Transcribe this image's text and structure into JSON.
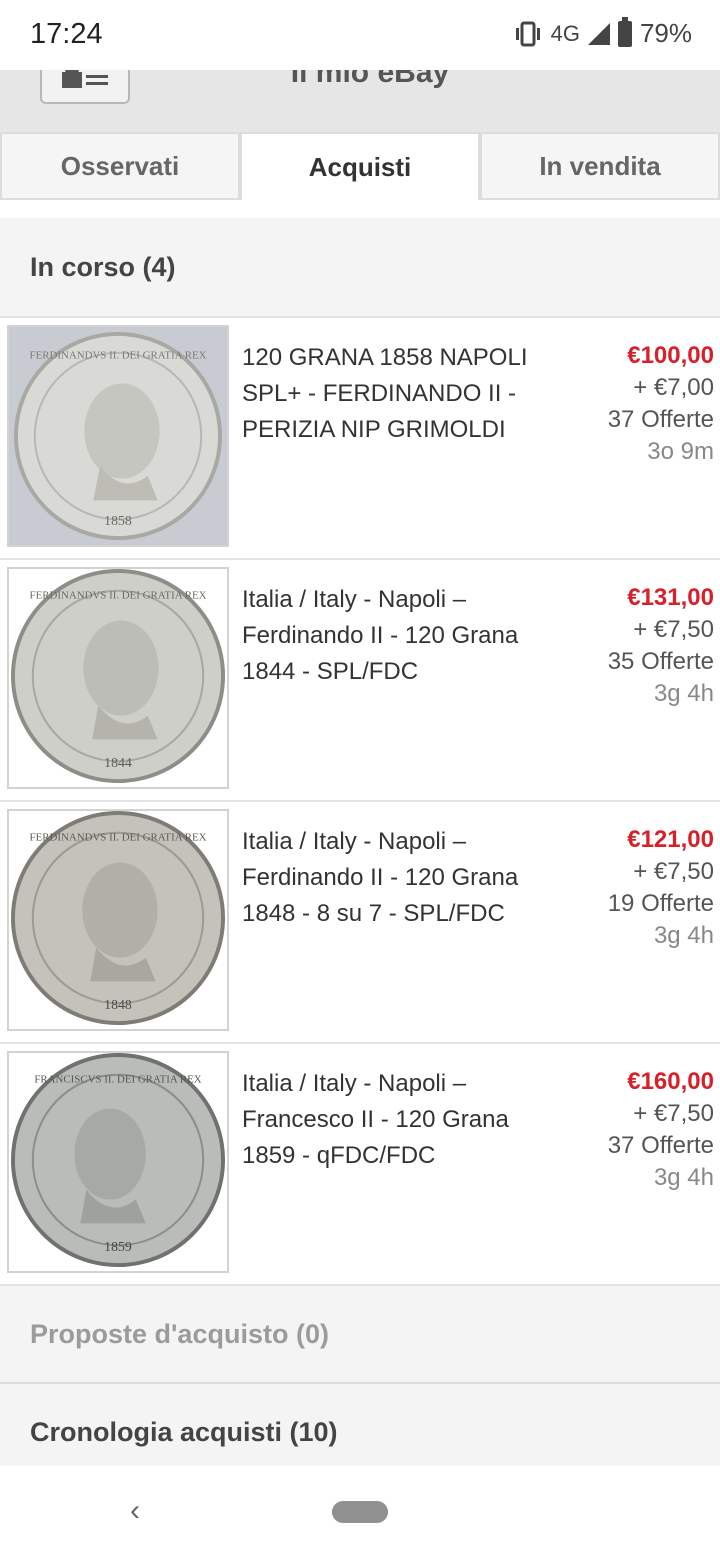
{
  "status": {
    "time": "17:24",
    "network": "4G",
    "battery": "79%"
  },
  "header": {
    "title": "Il mio eBay"
  },
  "tabs": [
    {
      "label": "Osservati",
      "active": false
    },
    {
      "label": "Acquisti",
      "active": true
    },
    {
      "label": "In vendita",
      "active": false
    }
  ],
  "section": {
    "title": "In corso (4)"
  },
  "items": [
    {
      "title": "120 GRANA 1858 NAPOLI SPL+ - FERDINANDO II - PERIZIA NIP GRIMOLDI",
      "price": "€100,00",
      "shipping": "+ €7,00",
      "bids": "37 Offerte",
      "time_left": "3o 9m",
      "coin_legend": "FERDINANDVS II. DEI GRATIA REX",
      "coin_year": "1858"
    },
    {
      "title": "Italia / Italy - Napoli – Ferdinando II - 120 Grana 1844 - SPL/FDC",
      "price": "€131,00",
      "shipping": "+ €7,50",
      "bids": "35 Offerte",
      "time_left": "3g 4h",
      "coin_legend": "FERDINANDVS II. DEI GRATIA REX",
      "coin_year": "1844"
    },
    {
      "title": "Italia / Italy - Napoli – Ferdinando II - 120 Grana 1848 - 8 su 7 - SPL/FDC",
      "price": "€121,00",
      "shipping": "+ €7,50",
      "bids": "19 Offerte",
      "time_left": "3g 4h",
      "coin_legend": "FERDINANDVS II. DEI GRATIA REX",
      "coin_year": "1848"
    },
    {
      "title": "Italia / Italy - Napoli – Francesco II - 120 Grana 1859 - qFDC/FDC",
      "price": "€160,00",
      "shipping": "+ €7,50",
      "bids": "37 Offerte",
      "time_left": "3g 4h",
      "coin_legend": "FRANCISCVS II. DEI GRATIA REX",
      "coin_year": "1859"
    }
  ],
  "sections_collapsed": [
    {
      "title": "Proposte d'acquisto (0)",
      "dim": true
    },
    {
      "title": "Cronologia acquisti (10)",
      "dim": false
    }
  ],
  "colors": {
    "price": "#d6212a",
    "header_bg": "#e6e6e6",
    "section_bg": "#f4f4f4"
  }
}
